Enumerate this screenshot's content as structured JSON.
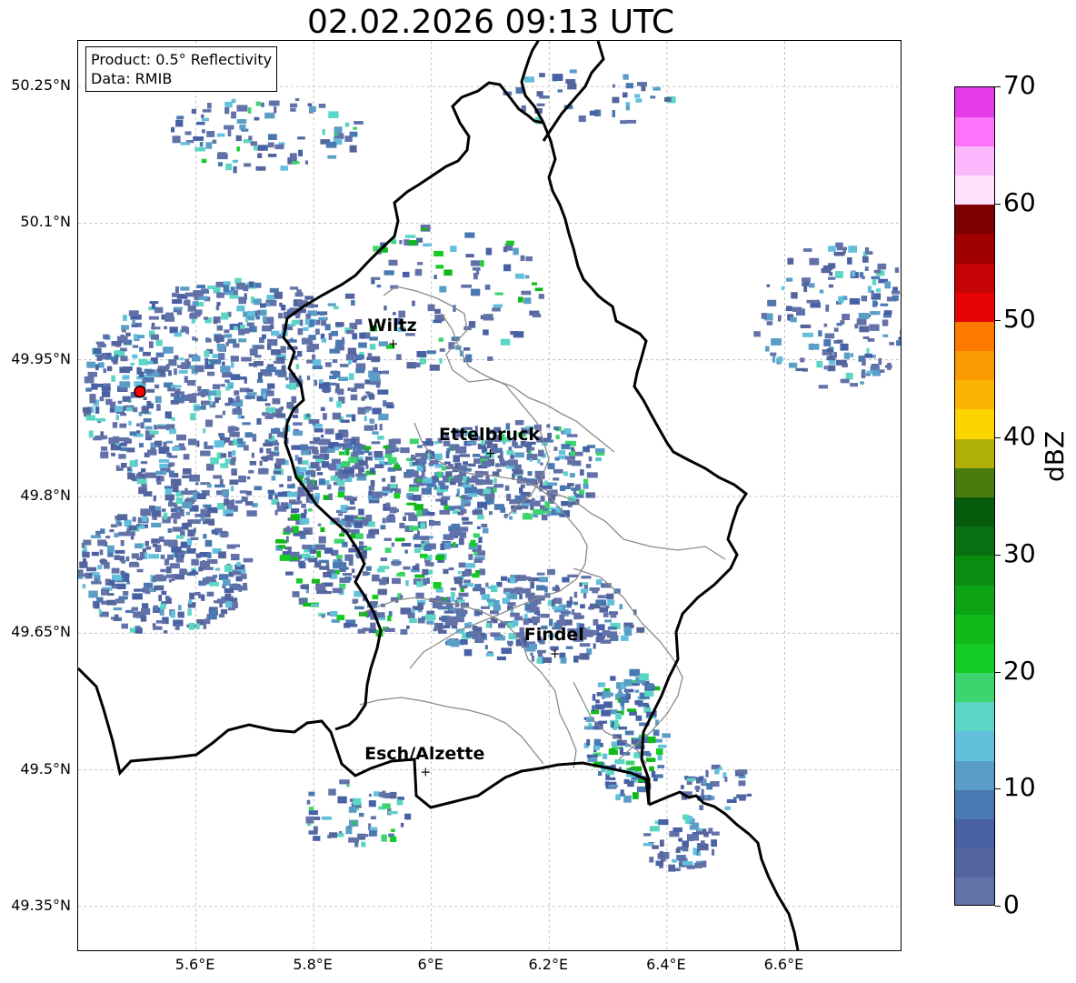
{
  "title": "02.02.2026 09:13 UTC",
  "info": {
    "product": "Product: 0.5° Reflectivity",
    "data": "Data: RMIB"
  },
  "axes": {
    "lon_ticks": [
      {
        "value": 5.6,
        "label": "5.6°E"
      },
      {
        "value": 5.8,
        "label": "5.8°E"
      },
      {
        "value": 6.0,
        "label": "6°E"
      },
      {
        "value": 6.2,
        "label": "6.2°E"
      },
      {
        "value": 6.4,
        "label": "6.4°E"
      },
      {
        "value": 6.6,
        "label": "6.6°E"
      }
    ],
    "lat_ticks": [
      {
        "value": 50.25,
        "label": "50.25°N"
      },
      {
        "value": 50.1,
        "label": "50.1°N"
      },
      {
        "value": 49.95,
        "label": "49.95°N"
      },
      {
        "value": 49.8,
        "label": "49.8°N"
      },
      {
        "value": 49.65,
        "label": "49.65°N"
      },
      {
        "value": 49.5,
        "label": "49.5°N"
      },
      {
        "value": 49.35,
        "label": "49.35°N"
      }
    ],
    "lon_range": [
      5.4,
      6.8
    ],
    "lat_range": [
      49.3,
      50.3
    ],
    "grid": true
  },
  "colorbar": {
    "label": "dBZ",
    "range": [
      0,
      70
    ],
    "ticks": [
      {
        "value": 70,
        "label": "70"
      },
      {
        "value": 60,
        "label": "60"
      },
      {
        "value": 50,
        "label": "50"
      },
      {
        "value": 40,
        "label": "40"
      },
      {
        "value": 30,
        "label": "30"
      },
      {
        "value": 20,
        "label": "20"
      },
      {
        "value": 10,
        "label": "10"
      },
      {
        "value": 0,
        "label": "0"
      }
    ],
    "colors": [
      "#6272a8",
      "#54659e",
      "#4860a4",
      "#4a78b0",
      "#5a9ec8",
      "#62c0dc",
      "#5cd6c4",
      "#3cd46c",
      "#14cc24",
      "#10b818",
      "#0ca414",
      "#0a8c10",
      "#087010",
      "#065a0c",
      "#487c0c",
      "#b0b008",
      "#fcd400",
      "#fcb404",
      "#fc9a04",
      "#fc7a00",
      "#e80404",
      "#c40404",
      "#a00000",
      "#7c0000",
      "#fce0fc",
      "#fcb8fc",
      "#fc74fc",
      "#e43ce8"
    ]
  },
  "cities": [
    {
      "name": "Wiltz",
      "lon": 5.935,
      "lat": 49.968
    },
    {
      "name": "Ettelbruck",
      "lon": 6.1,
      "lat": 49.848
    },
    {
      "name": "Findel",
      "lon": 6.21,
      "lat": 49.628
    },
    {
      "name": "Esch/Alzette",
      "lon": 5.99,
      "lat": 49.498
    }
  ],
  "radar_site": {
    "lon": 5.505,
    "lat": 49.915,
    "color": "#ff0000"
  },
  "colors": {
    "border": "#000000",
    "admin": "#8a8a8a",
    "grid": "#b4b4b4"
  }
}
